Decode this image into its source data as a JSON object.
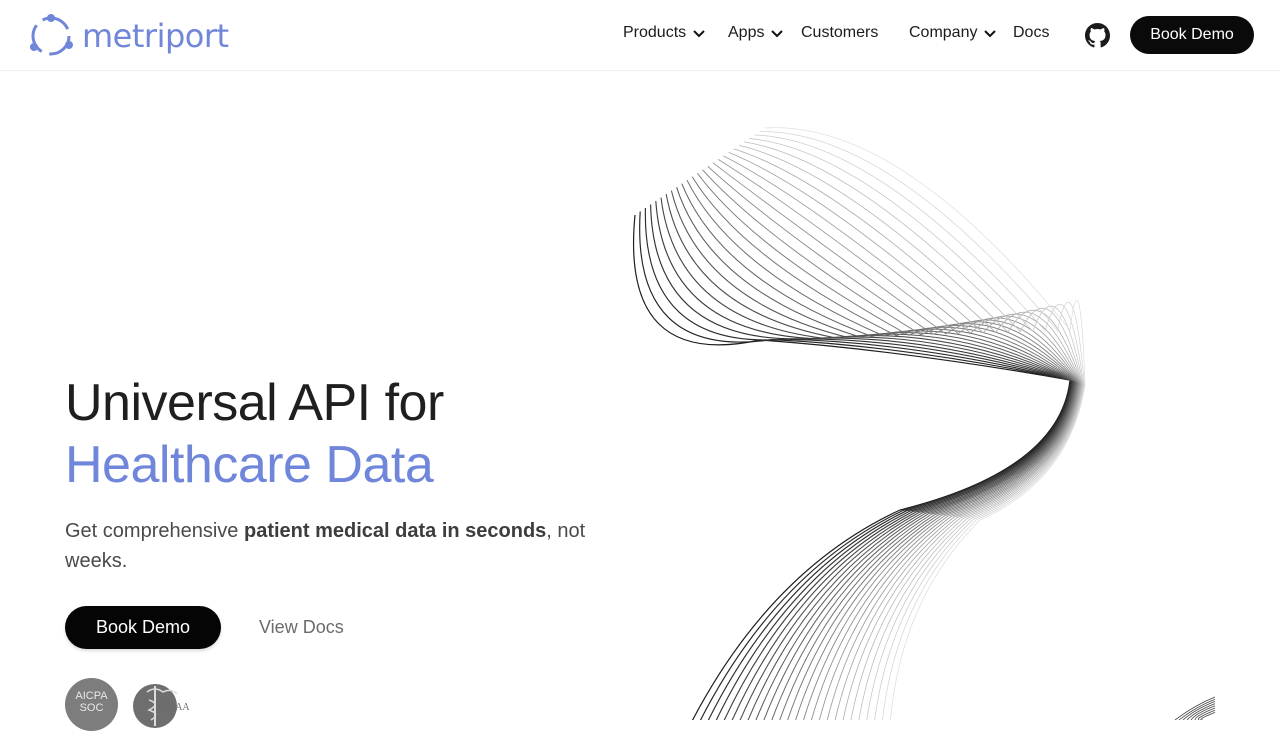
{
  "brand": {
    "name": "metriport",
    "color": "#6f86db"
  },
  "nav": {
    "items": [
      {
        "label": "Products",
        "dropdown": true
      },
      {
        "label": "Apps",
        "dropdown": true
      },
      {
        "label": "Customers",
        "dropdown": false
      },
      {
        "label": "Company",
        "dropdown": true
      },
      {
        "label": "Docs",
        "dropdown": false
      }
    ],
    "github_icon": "github-icon",
    "cta_label": "Book Demo"
  },
  "hero": {
    "title_line1": "Universal API for",
    "title_line2": "Healthcare Data",
    "subtitle_pre": "Get comprehensive ",
    "subtitle_bold": "patient medical data in seconds",
    "subtitle_post": ", not weeks.",
    "primary_cta": "Book Demo",
    "secondary_cta": "View Docs"
  },
  "badges": {
    "aicpa_line1": "AICPA",
    "aicpa_line2": "SOC",
    "hipaa": "HIPAA"
  }
}
